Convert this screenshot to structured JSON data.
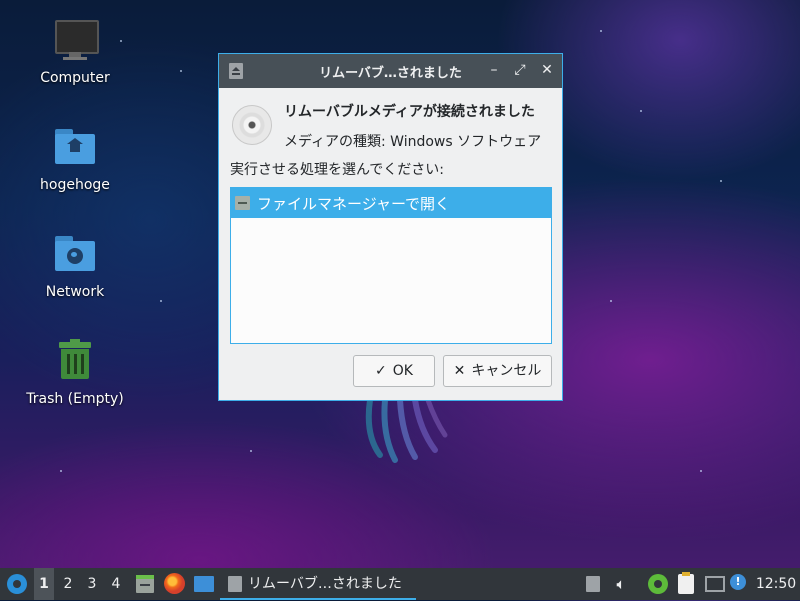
{
  "desktop": {
    "icons": [
      {
        "label": "Computer",
        "icon": "computer-monitor-icon"
      },
      {
        "label": "hogehoge",
        "icon": "home-folder-icon"
      },
      {
        "label": "Network",
        "icon": "network-folder-icon"
      },
      {
        "label": "Trash (Empty)",
        "icon": "trash-icon"
      }
    ]
  },
  "dialog": {
    "title": "リムーバブ…されました",
    "heading": "リムーバブルメディアが接続されました",
    "media_type": "メディアの種類: Windows ソフトウェア",
    "prompt": "実行させる処理を選んでください:",
    "actions": [
      {
        "label": "ファイルマネージャーで開く",
        "selected": true,
        "icon": "file-manager-icon"
      }
    ],
    "ok_label": "OK",
    "cancel_label": "キャンセル",
    "controls": {
      "minimize": "minimize-icon",
      "maximize": "maximize-icon",
      "close": "close-icon"
    }
  },
  "taskbar": {
    "workspaces": [
      "1",
      "2",
      "3",
      "4"
    ],
    "active_workspace": "1",
    "launchers": [
      "file-manager-icon",
      "firefox-icon",
      "desktop-icon"
    ],
    "task_label": "リムーバブ…されました",
    "clock": "12:50",
    "tray": [
      "eject-icon",
      "volume-icon",
      "network-status-icon",
      "clipboard-icon",
      "display-icon",
      "notification-icon"
    ]
  },
  "colors": {
    "accent": "#3daee9",
    "titlebar": "#475057",
    "panel": "#31363b"
  }
}
